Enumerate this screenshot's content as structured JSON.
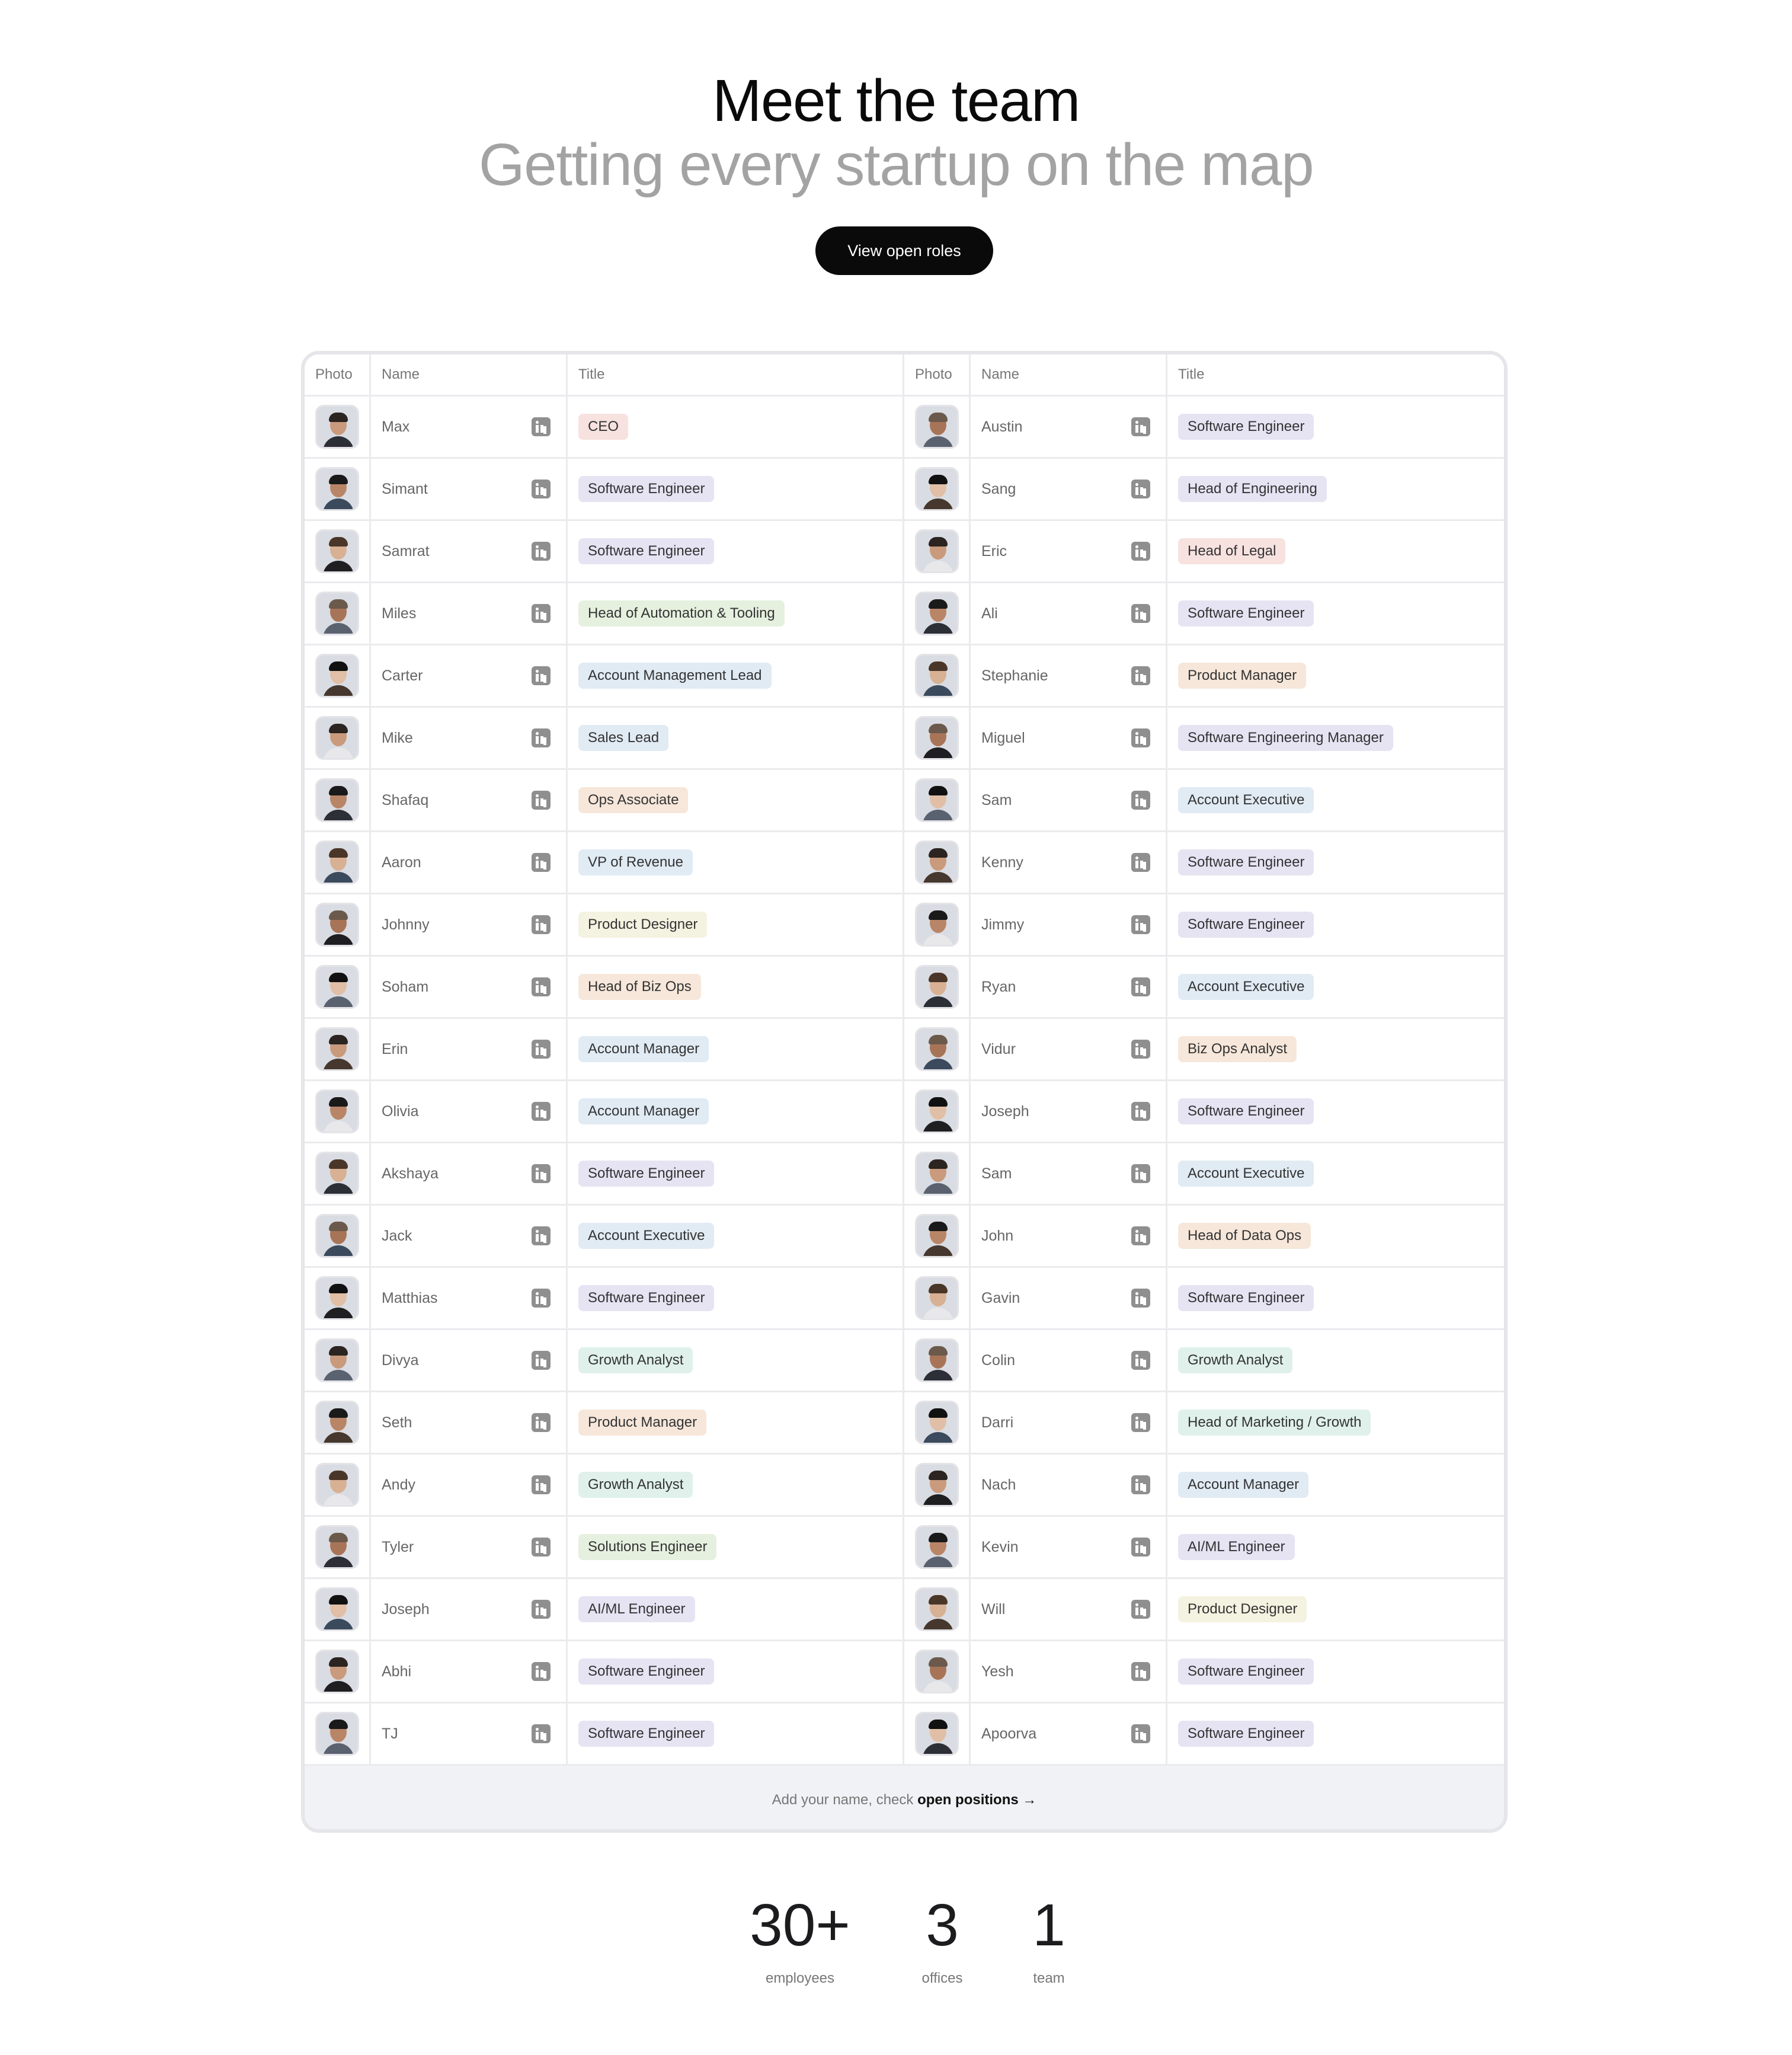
{
  "hero": {
    "title": "Meet the team",
    "subtitle": "Getting every startup on the map",
    "cta_label": "View open roles"
  },
  "table": {
    "headers": {
      "photo": "Photo",
      "name": "Name",
      "title": "Title"
    },
    "left": [
      {
        "name": "Max",
        "title": "CEO",
        "tag": "#f7e2e0"
      },
      {
        "name": "Simant",
        "title": "Software Engineer",
        "tag": "#e6e3f3"
      },
      {
        "name": "Samrat",
        "title": "Software Engineer",
        "tag": "#e6e3f3"
      },
      {
        "name": "Miles",
        "title": "Head of Automation & Tooling",
        "tag": "#e6f0df"
      },
      {
        "name": "Carter",
        "title": "Account Management Lead",
        "tag": "#e1ebf4"
      },
      {
        "name": "Mike",
        "title": "Sales Lead",
        "tag": "#e1ebf4"
      },
      {
        "name": "Shafaq",
        "title": "Ops Associate",
        "tag": "#f6e7da"
      },
      {
        "name": "Aaron",
        "title": "VP of Revenue",
        "tag": "#e1ebf4"
      },
      {
        "name": "Johnny",
        "title": "Product Designer",
        "tag": "#f4f2e0"
      },
      {
        "name": "Soham",
        "title": "Head of Biz Ops",
        "tag": "#f6e7da"
      },
      {
        "name": "Erin",
        "title": "Account Manager",
        "tag": "#e1ebf4"
      },
      {
        "name": "Olivia",
        "title": "Account Manager",
        "tag": "#e1ebf4"
      },
      {
        "name": "Akshaya",
        "title": "Software Engineer",
        "tag": "#e6e3f3"
      },
      {
        "name": "Jack",
        "title": "Account Executive",
        "tag": "#e1ebf4"
      },
      {
        "name": "Matthias",
        "title": "Software Engineer",
        "tag": "#e6e3f3"
      },
      {
        "name": "Divya",
        "title": "Growth Analyst",
        "tag": "#e0f1ec"
      },
      {
        "name": "Seth",
        "title": "Product Manager",
        "tag": "#f6e7da"
      },
      {
        "name": "Andy",
        "title": "Growth Analyst",
        "tag": "#e0f1ec"
      },
      {
        "name": "Tyler",
        "title": "Solutions Engineer",
        "tag": "#e6f0df"
      },
      {
        "name": "Joseph",
        "title": "AI/ML Engineer",
        "tag": "#e6e3f3"
      },
      {
        "name": "Abhi",
        "title": "Software Engineer",
        "tag": "#e6e3f3"
      },
      {
        "name": "TJ",
        "title": "Software Engineer",
        "tag": "#e6e3f3"
      }
    ],
    "right": [
      {
        "name": "Austin",
        "title": "Software Engineer",
        "tag": "#e6e3f3"
      },
      {
        "name": "Sang",
        "title": "Head of Engineering",
        "tag": "#e6e3f3"
      },
      {
        "name": "Eric",
        "title": "Head of Legal",
        "tag": "#f7e2e0"
      },
      {
        "name": "Ali",
        "title": "Software Engineer",
        "tag": "#e6e3f3"
      },
      {
        "name": "Stephanie",
        "title": "Product Manager",
        "tag": "#f6e7da"
      },
      {
        "name": "Miguel",
        "title": "Software Engineering Manager",
        "tag": "#e6e3f3"
      },
      {
        "name": "Sam",
        "title": "Account Executive",
        "tag": "#e1ebf4"
      },
      {
        "name": "Kenny",
        "title": "Software Engineer",
        "tag": "#e6e3f3"
      },
      {
        "name": "Jimmy",
        "title": "Software Engineer",
        "tag": "#e6e3f3"
      },
      {
        "name": "Ryan",
        "title": "Account Executive",
        "tag": "#e1ebf4"
      },
      {
        "name": "Vidur",
        "title": "Biz Ops Analyst",
        "tag": "#f6e7da"
      },
      {
        "name": "Joseph",
        "title": "Software Engineer",
        "tag": "#e6e3f3"
      },
      {
        "name": "Sam",
        "title": "Account Executive",
        "tag": "#e1ebf4"
      },
      {
        "name": "John",
        "title": "Head of Data Ops",
        "tag": "#f6e7da"
      },
      {
        "name": "Gavin",
        "title": "Software Engineer",
        "tag": "#e6e3f3"
      },
      {
        "name": "Colin",
        "title": "Growth Analyst",
        "tag": "#e0f1ec"
      },
      {
        "name": "Darri",
        "title": "Head of Marketing / Growth",
        "tag": "#e0f1ec"
      },
      {
        "name": "Nach",
        "title": "Account Manager",
        "tag": "#e1ebf4"
      },
      {
        "name": "Kevin",
        "title": "AI/ML Engineer",
        "tag": "#e6e3f3"
      },
      {
        "name": "Will",
        "title": "Product Designer",
        "tag": "#f4f2e0"
      },
      {
        "name": "Yesh",
        "title": "Software Engineer",
        "tag": "#e6e3f3"
      },
      {
        "name": "Apoorva",
        "title": "Software Engineer",
        "tag": "#e6e3f3"
      }
    ],
    "footer_prefix": "Add your name, check ",
    "footer_link": "open positions →"
  },
  "stats": [
    {
      "value": "30+",
      "label": "employees"
    },
    {
      "value": "3",
      "label": "offices"
    },
    {
      "value": "1",
      "label": "team"
    }
  ],
  "icons": {
    "linkedin": "linkedin-icon"
  }
}
